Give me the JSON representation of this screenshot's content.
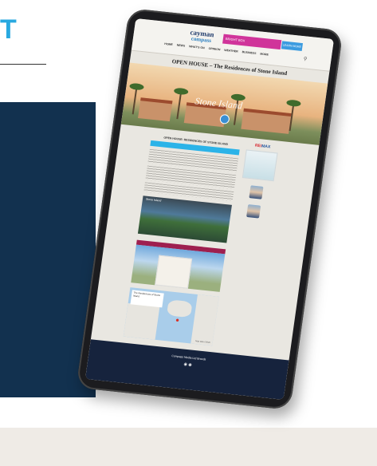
{
  "background": {
    "heading_letter": "T",
    "accent_color": "#29a9e0",
    "panel_color": "#12314f"
  },
  "site": {
    "logo_line1": "cayman",
    "logo_line2": "compass",
    "promo_text": "BRIGHT BOX",
    "promo_button": "LEARN MORE",
    "nav": [
      "HOME",
      "NEWS",
      "WHAT'S ON",
      "OPINION",
      "WEATHER",
      "BUSINESS",
      "MORE"
    ],
    "search_icon": "search-icon"
  },
  "page": {
    "title": "OPEN HOUSE – The Residences of Stone Island",
    "hero_script": "Stone Island",
    "section_heading": "OPEN HOUSE: RESIDENCES OF STONE ISLAND",
    "blue_bar": "",
    "pool_caption": "Stone Island",
    "magenta_bar": "",
    "tower_caption": "",
    "map_card": "The Residences of Stone Island",
    "map_footer": "Map data ©2020"
  },
  "sidebar": {
    "brand_red": "RE/",
    "brand_blue": "MAX",
    "agents": [
      {
        "name": "",
        "info": ""
      },
      {
        "name": "",
        "info": ""
      }
    ]
  },
  "footer": {
    "heading": "Compass Media Ltd Brands",
    "icons": [
      "◉  ◉"
    ],
    "line": "",
    "links": "",
    "copyright": ""
  }
}
